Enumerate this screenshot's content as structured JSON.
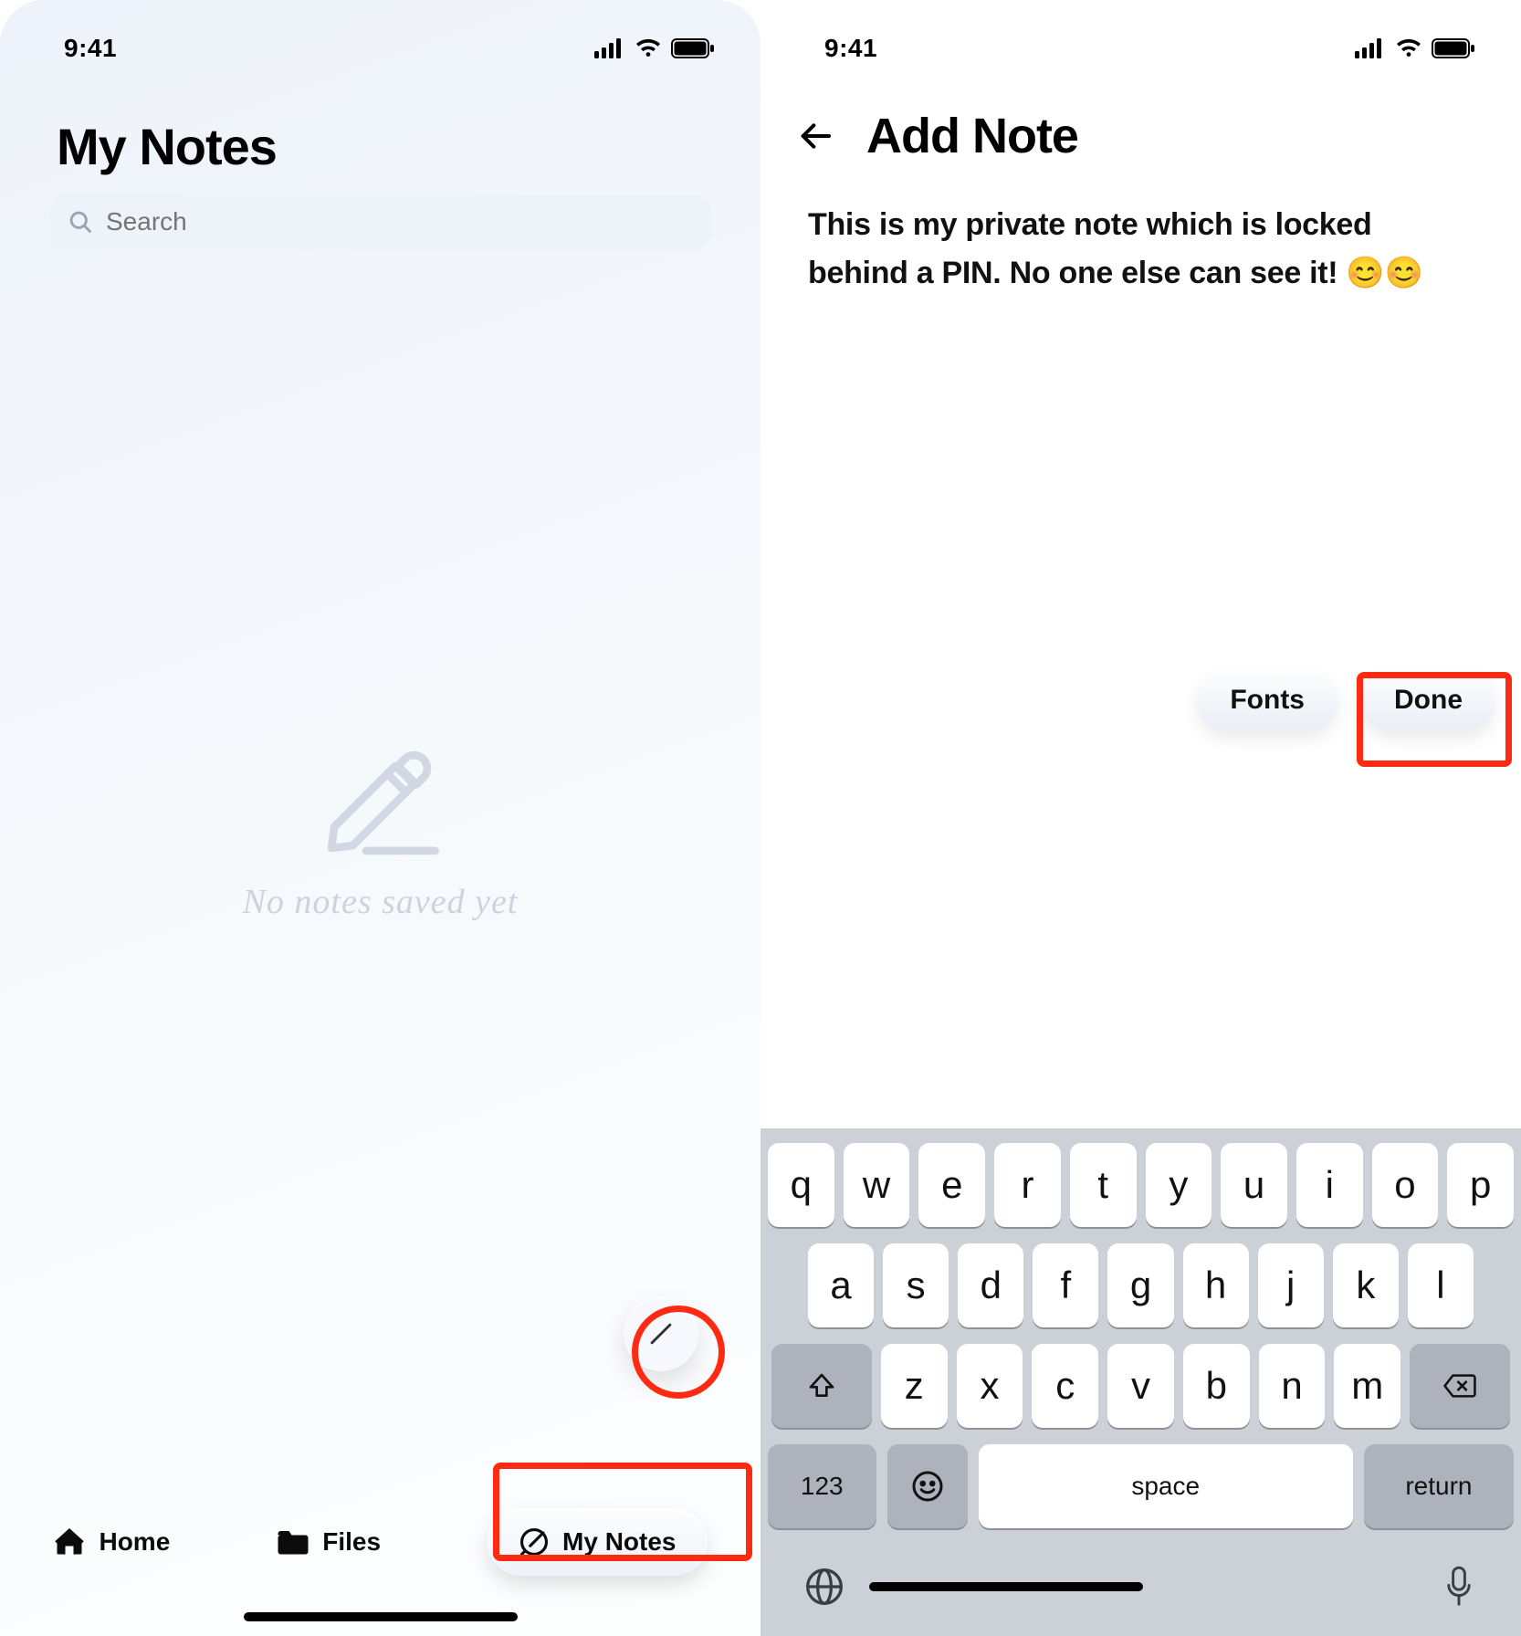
{
  "status": {
    "time": "9:41"
  },
  "left": {
    "title": "My Notes",
    "search_placeholder": "Search",
    "empty_state": "No notes saved yet",
    "tabs": {
      "home": "Home",
      "files": "Files",
      "mynotes": "My Notes"
    }
  },
  "right": {
    "title": "Add Note",
    "note_text": "This is my private note which is locked behind a PIN. No one else can see it! 😊😊",
    "fonts_label": "Fonts",
    "done_label": "Done"
  },
  "keyboard": {
    "row1": [
      "q",
      "w",
      "e",
      "r",
      "t",
      "y",
      "u",
      "i",
      "o",
      "p"
    ],
    "row2": [
      "a",
      "s",
      "d",
      "f",
      "g",
      "h",
      "j",
      "k",
      "l"
    ],
    "row3": [
      "z",
      "x",
      "c",
      "v",
      "b",
      "n",
      "m"
    ],
    "k123": "123",
    "space": "space",
    "return": "return"
  }
}
